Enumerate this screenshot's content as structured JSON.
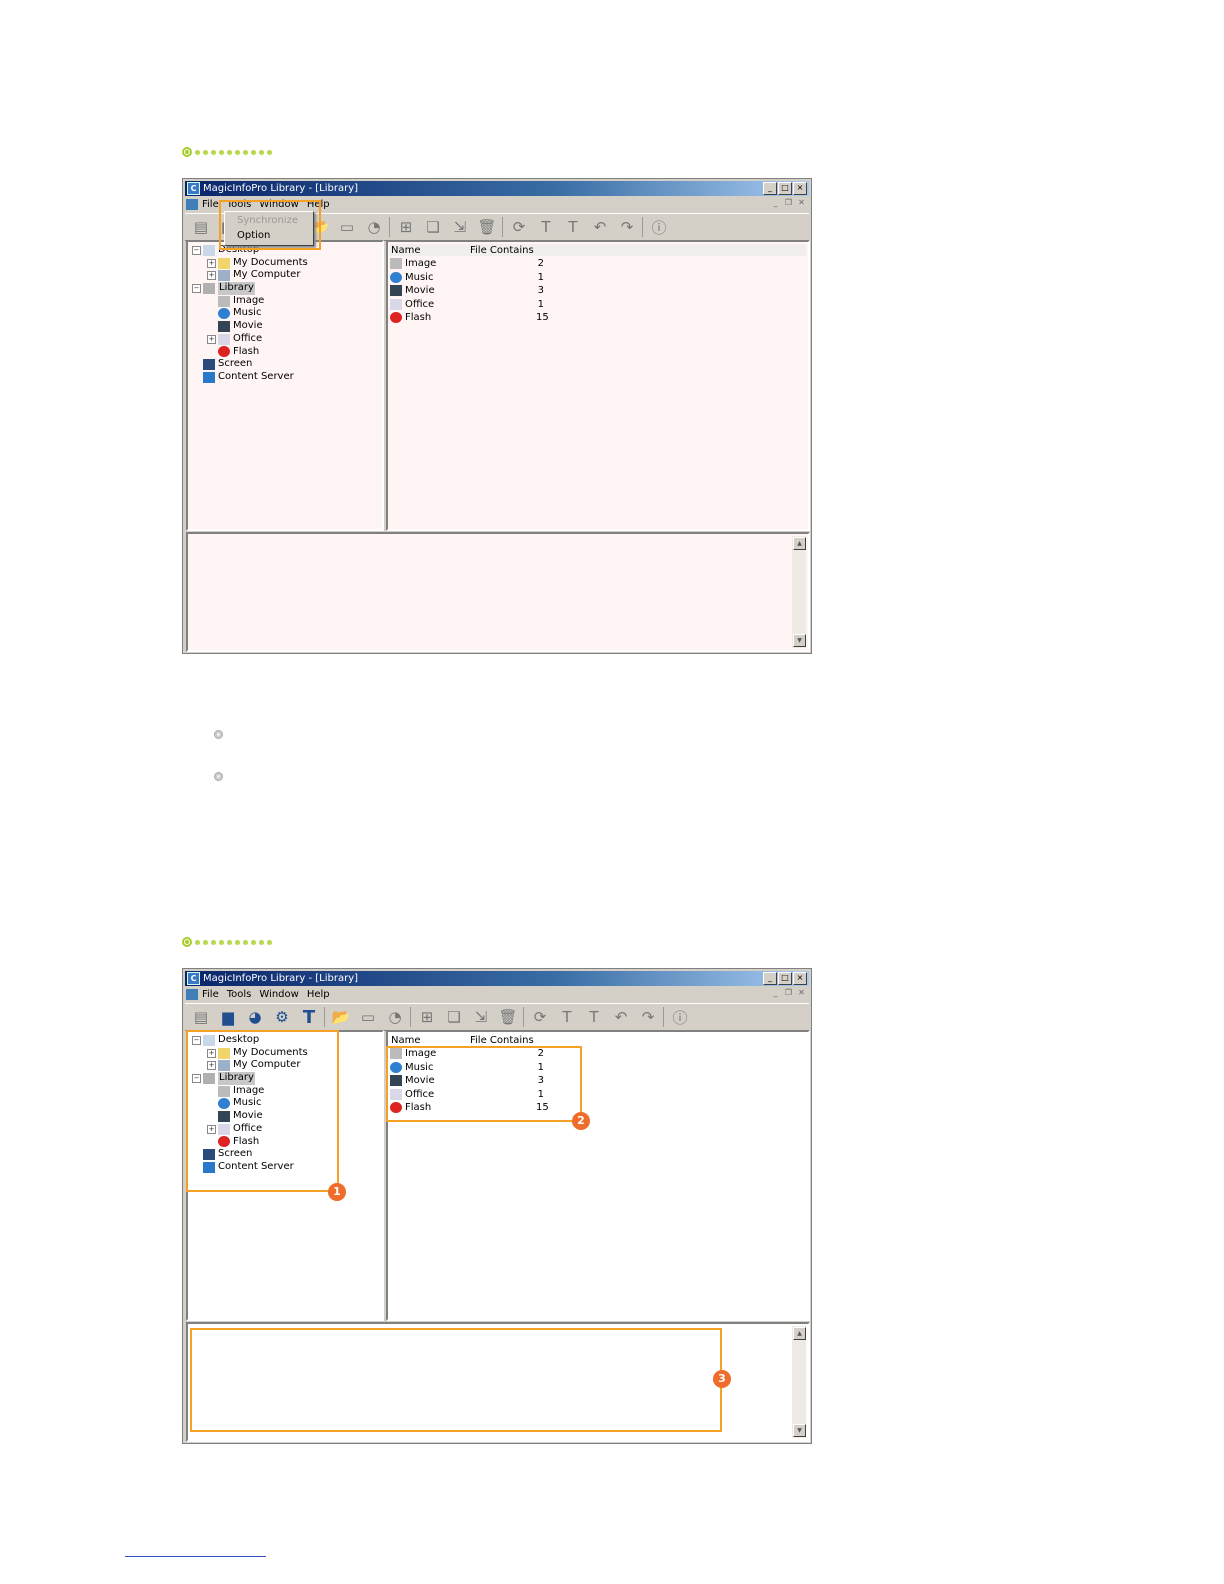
{
  "window": {
    "title": "MagicInfoPro Library - [Library]",
    "title_buttons": [
      "_",
      "□",
      "×"
    ]
  },
  "menu": {
    "items": [
      {
        "label": "File"
      },
      {
        "label": "Tools"
      },
      {
        "label": "Window"
      },
      {
        "label": "Help"
      }
    ]
  },
  "tools_dropdown": {
    "items": [
      "Synchronize",
      "Option"
    ]
  },
  "tree": {
    "nodes": [
      {
        "label": "Desktop"
      },
      {
        "label": "My Documents"
      },
      {
        "label": "My Computer"
      },
      {
        "label": "Library"
      },
      {
        "label": "Image"
      },
      {
        "label": "Music"
      },
      {
        "label": "Movie"
      },
      {
        "label": "Office"
      },
      {
        "label": "Flash"
      },
      {
        "label": "Screen"
      },
      {
        "label": "Content Server"
      }
    ]
  },
  "list": {
    "headers": [
      "Name",
      "File Contains"
    ],
    "rows": [
      {
        "name": "Image",
        "count": "2"
      },
      {
        "name": "Music",
        "count": "1"
      },
      {
        "name": "Movie",
        "count": "3"
      },
      {
        "name": "Office",
        "count": "1"
      },
      {
        "name": "Flash",
        "count": "15"
      }
    ]
  },
  "badges": [
    "1",
    "2",
    "3"
  ],
  "colors": {
    "highlight": "#f4a126",
    "badge": "#ef6c2b",
    "section_bullet": "#a8cc2e"
  }
}
